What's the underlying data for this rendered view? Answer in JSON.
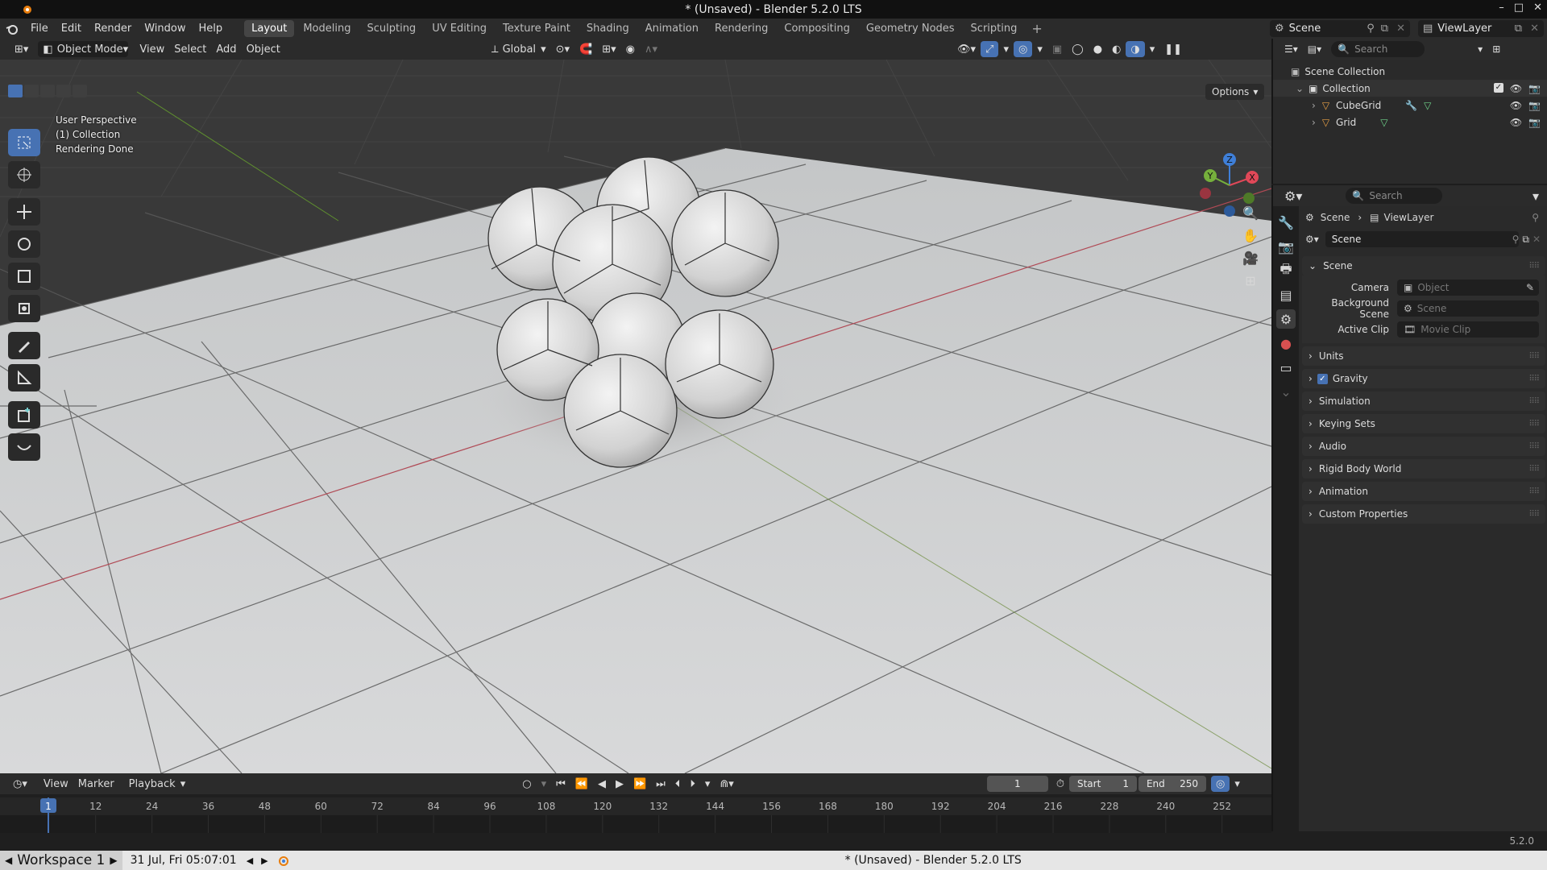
{
  "window_title": "* (Unsaved) - Blender 5.2.0 LTS",
  "menu": [
    "File",
    "Edit",
    "Render",
    "Window",
    "Help"
  ],
  "workspaces": [
    "Layout",
    "Modeling",
    "Sculpting",
    "UV Editing",
    "Texture Paint",
    "Shading",
    "Animation",
    "Rendering",
    "Compositing",
    "Geometry Nodes",
    "Scripting"
  ],
  "active_workspace": "Layout",
  "scene_name": "Scene",
  "view_layer": "ViewLayer",
  "viewport": {
    "mode": "Object Mode",
    "menus": [
      "View",
      "Select",
      "Add",
      "Object"
    ],
    "transform_orientation": "Global",
    "options_label": "Options",
    "info": [
      "User Perspective",
      "(1) Collection",
      "Rendering Done"
    ],
    "gizmo_axes": [
      "X",
      "Y",
      "Z"
    ]
  },
  "outliner": {
    "search_placeholder": "Search",
    "scene_collection": "Scene Collection",
    "collection": "Collection",
    "objects": [
      "CubeGrid",
      "Grid"
    ]
  },
  "properties": {
    "search_placeholder": "Search",
    "breadcrumb": [
      "Scene",
      "ViewLayer"
    ],
    "datablock": "Scene",
    "section": "Scene",
    "fields": [
      {
        "label": "Camera",
        "placeholder": "Object"
      },
      {
        "label": "Background Scene",
        "placeholder": "Scene"
      },
      {
        "label": "Active Clip",
        "placeholder": "Movie Clip"
      }
    ],
    "panels": [
      "Units",
      "Gravity",
      "Simulation",
      "Keying Sets",
      "Audio",
      "Rigid Body World",
      "Animation",
      "Custom Properties"
    ],
    "gravity_enabled": true
  },
  "timeline": {
    "menus": [
      "View",
      "Marker",
      "Playback"
    ],
    "current_frame": "1",
    "start_label": "Start",
    "start": "1",
    "end_label": "End",
    "end": "250",
    "ticks": [
      "1",
      "12",
      "24",
      "36",
      "48",
      "60",
      "72",
      "84",
      "96",
      "108",
      "120",
      "132",
      "144",
      "156",
      "168",
      "180",
      "192",
      "204",
      "216",
      "228",
      "240",
      "252"
    ]
  },
  "version": "5.2.0",
  "taskbar": {
    "workspace": "Workspace 1",
    "datetime": "31 Jul, Fri 05:07:01",
    "title": "* (Unsaved) - Blender 5.2.0 LTS"
  },
  "colors": {
    "accent": "#4772b3",
    "axis_x": "#e04858",
    "axis_y": "#76b03c",
    "axis_z": "#3f7fd8"
  }
}
